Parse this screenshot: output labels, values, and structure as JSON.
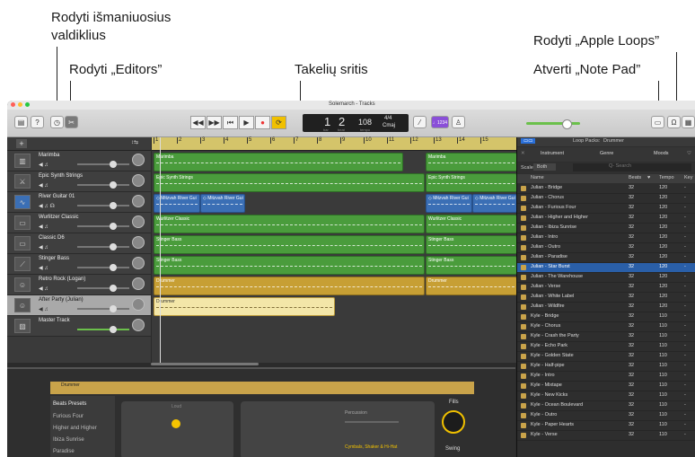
{
  "callouts": {
    "smart_controls": "Rodyti išmaniuosius\nvaldiklius",
    "editors": "Rodyti „Editors”",
    "tracks_area": "Takelių sritis",
    "apple_loops": "Rodyti „Apple Loops”",
    "note_pad": "Atverti „Note Pad”"
  },
  "window": {
    "title": "Solemarch - Tracks"
  },
  "toolbar": {
    "lcd_bar": "1",
    "lcd_beat": "2",
    "lcd_bar_label": "bar",
    "lcd_beat_label": "beat",
    "tempo": "108",
    "tempo_label": "tempo",
    "time_sig": "4/4",
    "key": "Cmaj",
    "count_in": "♩1234"
  },
  "tracks": [
    {
      "name": "Marimba",
      "icon": "marimba-icon",
      "selected": false
    },
    {
      "name": "Epic Synth Strings",
      "icon": "synth-icon",
      "selected": false
    },
    {
      "name": "River Guitar 01",
      "icon": "waveform-icon",
      "selected": false
    },
    {
      "name": "Wurlitzer Classic",
      "icon": "keyboard-icon",
      "selected": false
    },
    {
      "name": "Classic D6",
      "icon": "keyboard-icon",
      "selected": false
    },
    {
      "name": "Stinger Bass",
      "icon": "bass-icon",
      "selected": false
    },
    {
      "name": "Retro Rock (Logan)",
      "icon": "drummer-icon",
      "selected": false
    },
    {
      "name": "After Party (Julian)",
      "icon": "drummer-icon",
      "selected": true
    },
    {
      "name": "Master Track",
      "icon": "master-icon",
      "selected": false
    }
  ],
  "ruler": [
    "1",
    "2",
    "3",
    "4",
    "5",
    "6",
    "7",
    "8",
    "9",
    "10",
    "11",
    "12",
    "13",
    "14",
    "15"
  ],
  "regions": {
    "marimba": "Marimba",
    "epic": "Epic Synth Strings",
    "river1": "◇ Mitzvah River Gui",
    "river2": "◇ Mitzvah River Gui",
    "river3": "◇ Mitzvah River Gui",
    "river4": "◇ Mitzvah River Gui",
    "wurli": "Wurlitzer Classic",
    "stinger1": "Stinger Bass",
    "stinger2": "Stinger Bass",
    "drummer1": "Drummer",
    "drummer2": "Drummer"
  },
  "editor": {
    "header": "Drummer",
    "beats_presets": "Beats Presets",
    "presets": [
      "Furious Four",
      "Higher and Higher",
      "Ibiza Sunrise",
      "Paradise"
    ],
    "loud_label": "Loud",
    "percussion_label": "Percussion",
    "cymbals_label": "Cymbals, Shaker & Hi-Hat",
    "fills_label": "Fills",
    "swing_label": "Swing"
  },
  "loops": {
    "loop_packs_label": "Loop Packs:",
    "loop_pack_value": "Drummer",
    "categories": [
      "Instrument",
      "Genre",
      "Moods"
    ],
    "scale_label": "Scale",
    "scale_value": "Both",
    "search_placeholder": "Q- Search",
    "col_name": "Name",
    "col_beats": "Beats",
    "col_tempo": "Tempo",
    "col_key": "Key",
    "items": [
      {
        "name": "Julian - Bridge",
        "beats": "32",
        "tempo": "120",
        "key": "-"
      },
      {
        "name": "Julian - Chorus",
        "beats": "32",
        "tempo": "120",
        "key": "-"
      },
      {
        "name": "Julian - Furious Four",
        "beats": "32",
        "tempo": "120",
        "key": "-"
      },
      {
        "name": "Julian - Higher and Higher",
        "beats": "32",
        "tempo": "120",
        "key": "-"
      },
      {
        "name": "Julian - Ibiza Sunrise",
        "beats": "32",
        "tempo": "120",
        "key": "-"
      },
      {
        "name": "Julian - Intro",
        "beats": "32",
        "tempo": "120",
        "key": "-"
      },
      {
        "name": "Julian - Outro",
        "beats": "32",
        "tempo": "120",
        "key": "-"
      },
      {
        "name": "Julian - Paradise",
        "beats": "32",
        "tempo": "120",
        "key": "-"
      },
      {
        "name": "Julian - Star Burst",
        "beats": "32",
        "tempo": "120",
        "key": "-",
        "selected": true
      },
      {
        "name": "Julian - The Warehouse",
        "beats": "32",
        "tempo": "120",
        "key": "-"
      },
      {
        "name": "Julian - Verse",
        "beats": "32",
        "tempo": "120",
        "key": "-"
      },
      {
        "name": "Julian - White Label",
        "beats": "32",
        "tempo": "120",
        "key": "-"
      },
      {
        "name": "Julian - Wildfire",
        "beats": "32",
        "tempo": "120",
        "key": "-"
      },
      {
        "name": "Kyle - Bridge",
        "beats": "32",
        "tempo": "110",
        "key": "-"
      },
      {
        "name": "Kyle - Chorus",
        "beats": "32",
        "tempo": "110",
        "key": "-"
      },
      {
        "name": "Kyle - Crash the Party",
        "beats": "32",
        "tempo": "110",
        "key": "-"
      },
      {
        "name": "Kyle - Echo Park",
        "beats": "32",
        "tempo": "110",
        "key": "-"
      },
      {
        "name": "Kyle - Golden State",
        "beats": "32",
        "tempo": "110",
        "key": "-"
      },
      {
        "name": "Kyle - Half-pipe",
        "beats": "32",
        "tempo": "110",
        "key": "-"
      },
      {
        "name": "Kyle - Intro",
        "beats": "32",
        "tempo": "110",
        "key": "-"
      },
      {
        "name": "Kyle - Mixtape",
        "beats": "32",
        "tempo": "110",
        "key": "-"
      },
      {
        "name": "Kyle - New Kicks",
        "beats": "32",
        "tempo": "110",
        "key": "-"
      },
      {
        "name": "Kyle - Ocean Boulevard",
        "beats": "32",
        "tempo": "110",
        "key": "-"
      },
      {
        "name": "Kyle - Outro",
        "beats": "32",
        "tempo": "110",
        "key": "-"
      },
      {
        "name": "Kyle - Paper Hearts",
        "beats": "32",
        "tempo": "110",
        "key": "-"
      },
      {
        "name": "Kyle - Verse",
        "beats": "32",
        "tempo": "110",
        "key": "-"
      }
    ]
  }
}
